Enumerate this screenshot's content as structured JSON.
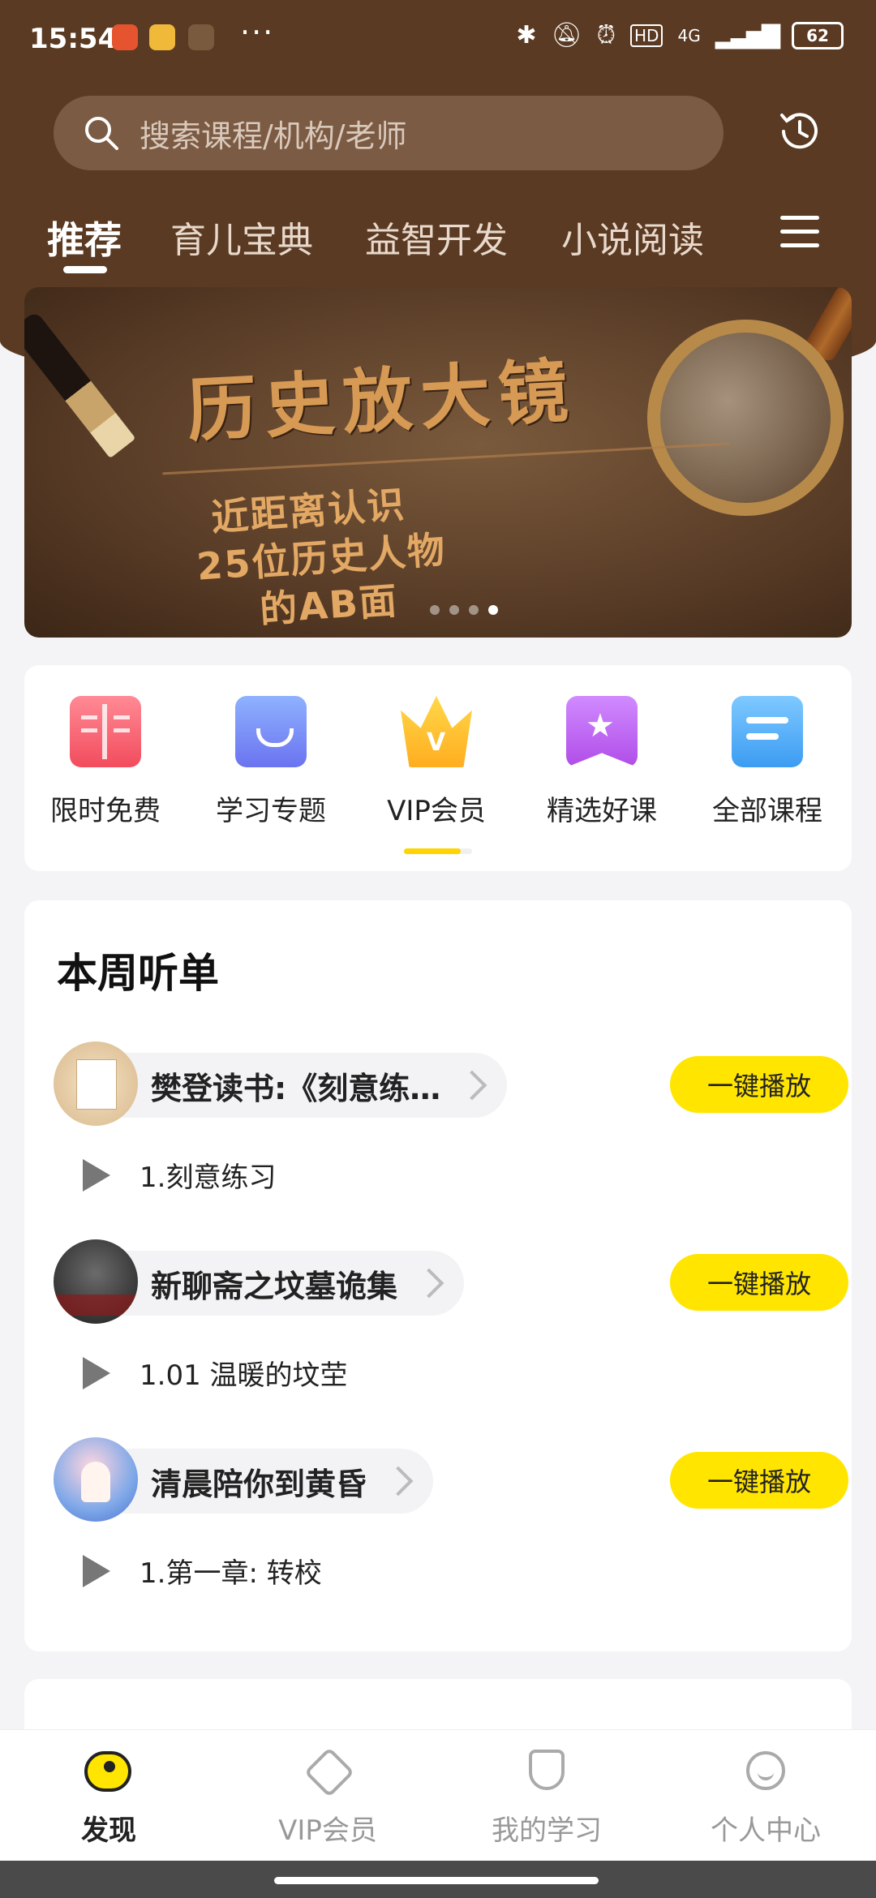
{
  "status_bar": {
    "time": "15:54",
    "more": "···",
    "network": "4G",
    "battery": "62"
  },
  "search": {
    "placeholder": "搜索课程/机构/老师"
  },
  "tabs": [
    {
      "label": "推荐"
    },
    {
      "label": "育儿宝典"
    },
    {
      "label": "益智开发"
    },
    {
      "label": "小说阅读"
    }
  ],
  "banner": {
    "title": "历史放大镜",
    "line1": "近距离认识",
    "line2": "25位历史人物",
    "line3": "的AB面"
  },
  "categories": [
    {
      "label": "限时免费",
      "icon": "book-icon"
    },
    {
      "label": "学习专题",
      "icon": "topic-bag-icon"
    },
    {
      "label": "VIP会员",
      "icon": "crown-icon"
    },
    {
      "label": "精选好课",
      "icon": "star-bookmark-icon"
    },
    {
      "label": "全部课程",
      "icon": "document-list-icon"
    }
  ],
  "weekly": {
    "title": "本周听单",
    "albums": [
      {
        "name": "樊登读书:《刻意练…",
        "play_label": "一键播放",
        "track": "1.刻意练习"
      },
      {
        "name": "新聊斋之坟墓诡集",
        "play_label": "一键播放",
        "track": "1.01 温暖的坟茔"
      },
      {
        "name": "清晨陪你到黄昏",
        "play_label": "一键播放",
        "track": "1.第一章: 转校"
      }
    ]
  },
  "bottom_nav": [
    {
      "label": "发现"
    },
    {
      "label": "VIP会员"
    },
    {
      "label": "我的学习"
    },
    {
      "label": "个人中心"
    }
  ],
  "colors": {
    "header_brown": "#5a3a22",
    "accent_yellow": "#ffe500"
  }
}
